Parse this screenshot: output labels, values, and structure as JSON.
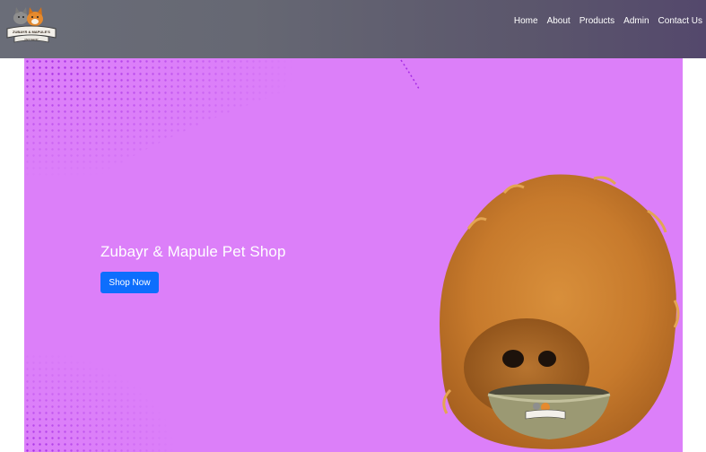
{
  "header": {
    "logo": {
      "line1": "ZUBAYR & MAPULE'S",
      "line2": "PET SHOP",
      "icon": "pet-shop-logo-icon"
    },
    "nav": [
      {
        "label": "Home"
      },
      {
        "label": "About"
      },
      {
        "label": "Products"
      },
      {
        "label": "Admin"
      },
      {
        "label": "Contact Us"
      }
    ],
    "colors": {
      "start": "#6a6d78",
      "end": "#54486c"
    }
  },
  "hero": {
    "title": "Zubayr & Mapule Pet Shop",
    "button_label": "Shop Now",
    "image": "pomeranian-eating-from-bowl",
    "colors": {
      "background": "#dc7ff9",
      "button": "#0d6efd",
      "dots": "#a42be3"
    }
  }
}
